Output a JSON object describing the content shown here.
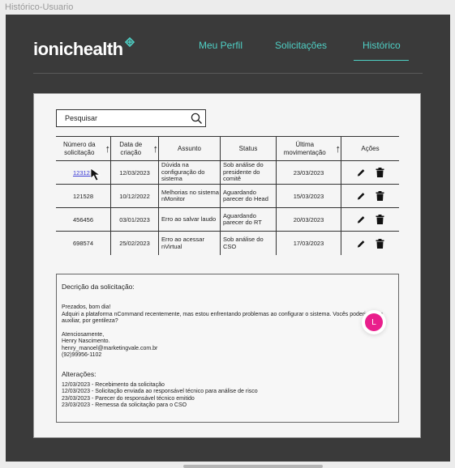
{
  "frame": {
    "title": "Histórico-Usuario"
  },
  "header": {
    "logo_text": "ionichealth",
    "nav": [
      {
        "label": "Meu Perfil"
      },
      {
        "label": "Solicitações"
      },
      {
        "label": "Histórico"
      }
    ],
    "accent_color": "#4fd0c5"
  },
  "search": {
    "placeholder": "Pesquisar"
  },
  "table": {
    "headers": [
      {
        "label": "Número da solicitação",
        "sortable": true
      },
      {
        "label": "Data de criação",
        "sortable": true
      },
      {
        "label": "Assunto",
        "sortable": false
      },
      {
        "label": "Status",
        "sortable": false
      },
      {
        "label": "Última movimentação",
        "sortable": true
      },
      {
        "label": "Ações",
        "sortable": false
      }
    ],
    "rows": [
      {
        "number": "123123",
        "created": "12/03/2023",
        "subject": "Dúvida na configuração do sistema",
        "status": "Sob análise do presidente do comitê",
        "last_update": "23/03/2023"
      },
      {
        "number": "121528",
        "created": "10/12/2022",
        "subject": "Melhorias no sistema nMonitor",
        "status": "Aguardando parecer do Head",
        "last_update": "15/03/2023"
      },
      {
        "number": "456456",
        "created": "03/01/2023",
        "subject": "Erro ao salvar laudo",
        "status": "Aguardando parecer do RT",
        "last_update": "20/03/2023"
      },
      {
        "number": "698574",
        "created": "25/02/2023",
        "subject": "Erro ao acessar nVirtual",
        "status": "Sob análise do CSO",
        "last_update": "17/03/2023"
      }
    ]
  },
  "description": {
    "title": "Decrição da solicitação:",
    "greeting": "Prezados, bom dia!",
    "body_line1": "Adquiri a plataforma nCommand recentemente, mas estou enfrentando problemas ao configurar o sistema. Vocês poderiam me",
    "body_line2": "auxiliar, por gentileza?",
    "signoff": "Atenciosamente,",
    "name": "Henry Nascimento.",
    "email": "henry_manoel@marketingvale.com.br",
    "phone": "(92)99956-1102",
    "changes_title": "Alterações:",
    "changes": [
      "12/03/2023 - Recebimento da solicitação",
      "12/03/2023 - Solicitação enviada ao responsável técnico para análise de risco",
      "23/03/2023 - Parecer do responsável técnico emitido",
      "23/03/2023 - Remessa da solicitação para o CSO"
    ]
  },
  "avatar": {
    "initial": "L",
    "color": "#e91e8c"
  }
}
